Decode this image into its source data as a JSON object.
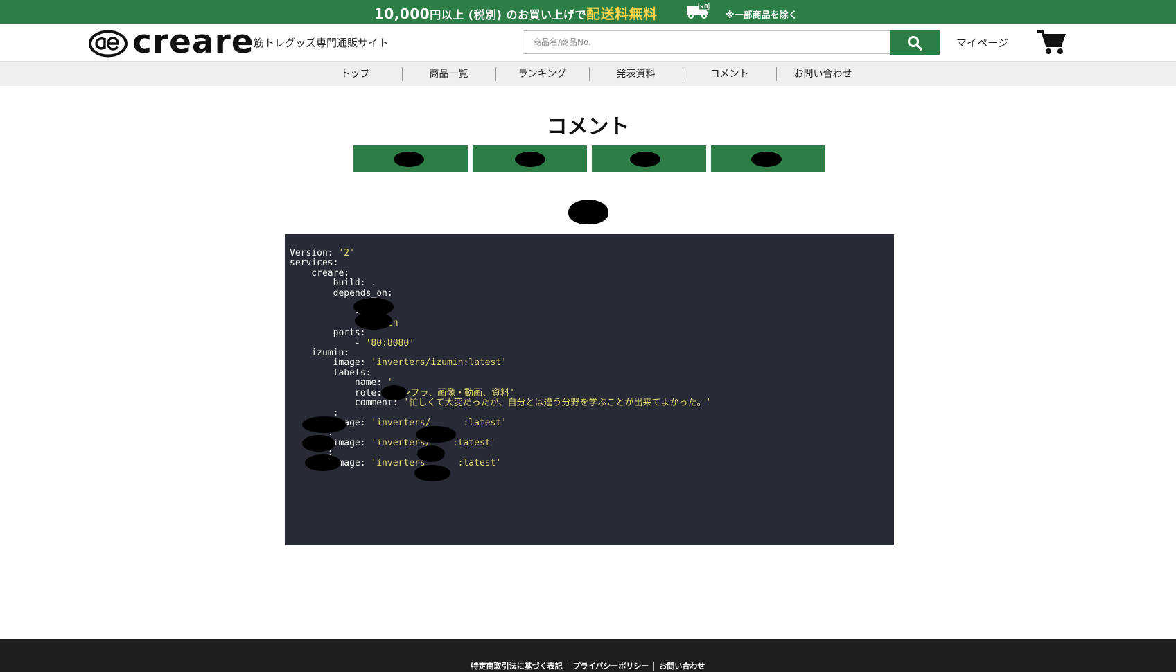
{
  "promo": {
    "amount": "10,000",
    "text_after_amount": "円以上 (税別) のお買い上げで",
    "free_shipping": "配送料無料",
    "cart_count": "×0",
    "note": "※一部商品を除く"
  },
  "header": {
    "logo_text": "creare",
    "tagline": "筋トレグッズ専門通販サイト",
    "search_placeholder": "商品名/商品No.",
    "mypage_label": "マイページ"
  },
  "nav": {
    "items": [
      {
        "label": "トップ"
      },
      {
        "label": "商品一覧"
      },
      {
        "label": "ランキング"
      },
      {
        "label": "発表資料"
      },
      {
        "label": "コメント"
      },
      {
        "label": "お問い合わせ"
      }
    ]
  },
  "main": {
    "title": "コメント"
  },
  "code": {
    "l1_key": "Version: ",
    "l1_val": "'2'",
    "l2": "services:",
    "l3": "    creare:",
    "l4": "        build: .",
    "l5": "        depends_on:",
    "l6": "            -",
    "l7": "            -",
    "l8_key": "            - ",
    "l8_val": "izumin",
    "l9": "        ports:",
    "l10_key": "            - ",
    "l10_val": "'80:8080'",
    "l11": "    izumin:",
    "l12_key": "        image: ",
    "l12_val": "'inverters/izumin:latest'",
    "l13": "        labels:",
    "l14_key": "            name: ",
    "l14_val": "'",
    "l15_key": "            role: ",
    "l15_val": "'インフラ、画像・動画、資料'",
    "l16_key": "            comment: ",
    "l16_val": "'忙しくて大変だったが、自分とは違う分野を学ぶことが出来てよかった。'",
    "l17": "        :",
    "l18_key": "        image: ",
    "l18_val_a": "'inverters/",
    "l18_val_b": ":latest'",
    "l19": "       :",
    "l20_key": "        image: ",
    "l20_val_a": "'inverters/",
    "l20_val_b": ":latest'",
    "l21": "       :",
    "l22_key": "        image: ",
    "l22_val_a": "'inverters",
    "l22_val_b": ":latest'"
  },
  "footer": {
    "links": [
      {
        "label": "特定商取引法に基づく表記"
      },
      {
        "label": "プライバシーポリシー"
      },
      {
        "label": "お問い合わせ"
      }
    ]
  },
  "colors": {
    "brand_green": "#2c7d46",
    "free_shipping_yellow": "#f4d24b",
    "code_background": "#282a36",
    "code_string": "#e6db74",
    "footer_background": "#1e1e1e"
  },
  "icons": {
    "logo_mark": "ae-ligature-logo-icon",
    "truck": "delivery-truck-icon",
    "search": "search-icon",
    "cart": "shopping-cart-icon"
  }
}
